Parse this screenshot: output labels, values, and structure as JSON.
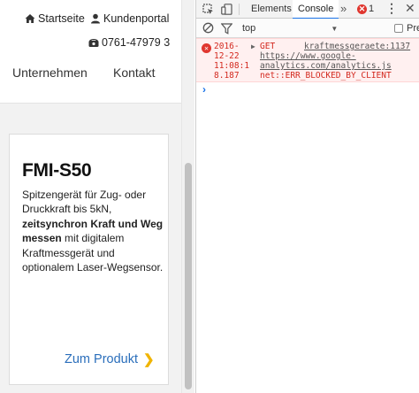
{
  "site": {
    "top_links": [
      {
        "label": "Startseite",
        "icon": "home-icon"
      },
      {
        "label": "Kundenportal",
        "icon": "user-icon"
      }
    ],
    "phone": {
      "label": "0761-47979 3",
      "icon": "phone-icon"
    },
    "nav": [
      {
        "label": "Unternehmen"
      },
      {
        "label": "Kontakt"
      }
    ],
    "card": {
      "title": "FMI-S50",
      "desc_part1": "Spitzengerät für Zug- oder Druckkraft bis 5kN,",
      "desc_bold": "zeitsynchron Kraft und Weg messen",
      "desc_part2": "mit digitalem Kraftmessgerät und optionalem Laser-Wegsensor.",
      "link_label": "Zum Produkt",
      "link_chevron": "❯"
    },
    "accent_link_color": "#2a6ebb",
    "accent_chevron_color": "#f0b400"
  },
  "devtools": {
    "tabs": [
      {
        "label": "Elements",
        "active": false
      },
      {
        "label": "Console",
        "active": true
      }
    ],
    "more_label": "»",
    "error_count": "1",
    "error_badge_icon": "✕",
    "kebab_label": "⋮",
    "close_label": "✕",
    "context": {
      "label": "top",
      "caret": "▼"
    },
    "preserve_label": "Pre",
    "console": {
      "error": {
        "icon": "✕",
        "timestamp": "2016-\n12-22\n11:08:1\n8.187",
        "method": "GET",
        "source": "kraftmessgeraete:1137",
        "url": "https://www.google-\nanalytics.com/analytics.js",
        "message": "net::ERR_BLOCKED_BY_CLIENT"
      },
      "prompt": "›"
    },
    "error_color": "#d3291f"
  }
}
